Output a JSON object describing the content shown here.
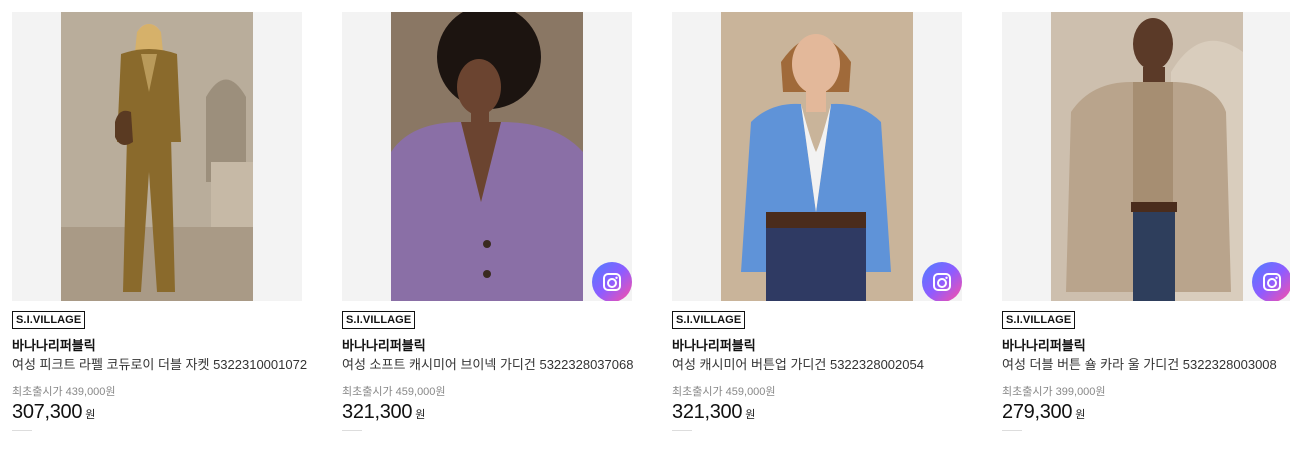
{
  "colors": {
    "lens_gradient": [
      "#4f7dff",
      "#8f5cff",
      "#ff4fa3"
    ],
    "price": "#111111",
    "muted": "#888888"
  },
  "products": [
    {
      "badge": "S.I.VILLAGE",
      "brand": "바나나리퍼블릭",
      "name": "여성 피크트 라펠 코듀로이 더블 자켓 5322310001072",
      "original_price": "최초출시가 439,000원",
      "price": "307,300",
      "currency": "원",
      "image": {
        "background": "#b9ad9b",
        "garment_color": "#8a6a2c",
        "has_lens_icon": false
      }
    },
    {
      "badge": "S.I.VILLAGE",
      "brand": "바나나리퍼블릭",
      "name": "여성 소프트 캐시미어 브이넥 가디건 5322328037068",
      "original_price": "최초출시가 459,000원",
      "price": "321,300",
      "currency": "원",
      "image": {
        "background": "#8a7764",
        "garment_color": "#8a6fa6",
        "has_lens_icon": true
      }
    },
    {
      "badge": "S.I.VILLAGE",
      "brand": "바나나리퍼블릭",
      "name": "여성 캐시미어 버튼업 가디건 5322328002054",
      "original_price": "최초출시가 459,000원",
      "price": "321,300",
      "currency": "원",
      "image": {
        "background": "#c9b49a",
        "garment_color": "#5f93d8",
        "has_lens_icon": true
      }
    },
    {
      "badge": "S.I.VILLAGE",
      "brand": "바나나리퍼블릭",
      "name": "여성 더블 버튼 숄 카라 울 가디건 5322328003008",
      "original_price": "최초출시가 399,000원",
      "price": "279,300",
      "currency": "원",
      "image": {
        "background": "#cdbfae",
        "garment_color": "#b9a48c",
        "has_lens_icon": true
      }
    }
  ]
}
